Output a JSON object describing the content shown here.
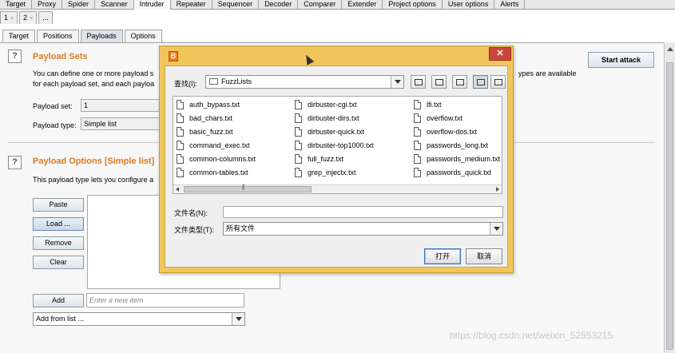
{
  "main_tabs": [
    "Target",
    "Proxy",
    "Spider",
    "Scanner",
    "Intruder",
    "Repeater",
    "Sequencer",
    "Decoder",
    "Comparer",
    "Extender",
    "Project options",
    "User options",
    "Alerts"
  ],
  "sub_tabs": [
    {
      "label": "1",
      "close": "×"
    },
    {
      "label": "2",
      "close": "×"
    },
    {
      "label": "...",
      "close": ""
    }
  ],
  "intruder_tabs": [
    "Target",
    "Positions",
    "Payloads",
    "Options"
  ],
  "payload_sets": {
    "help": "?",
    "title": "Payload Sets",
    "desc_line1_left": "You can define one or more payload s",
    "desc_line1_right": "ypes are available",
    "desc_line2": "for each payload set, and each payloa",
    "set_label": "Payload set:",
    "set_value": "1",
    "type_label": "Payload type:",
    "type_value": "Simple list"
  },
  "start_attack": "Start attack",
  "payload_options": {
    "help": "?",
    "title": "Payload Options [Simple list]",
    "desc": "This payload type lets you configure a",
    "buttons": [
      "Paste",
      "Load ...",
      "Remove",
      "Clear"
    ],
    "add_label": "Add",
    "add_placeholder": "Enter a new item",
    "add_from_list": "Add from list ..."
  },
  "dialog": {
    "logo": "B",
    "close": "✕",
    "lookin_label": "查找(I):",
    "lookin_value": "FuzzLists",
    "files": [
      "auth_bypass.txt",
      "bad_chars.txt",
      "basic_fuzz.txt",
      "command_exec.txt",
      "common-columns.txt",
      "common-tables.txt",
      "dirbuster-cgi.txt",
      "dirbuster-dirs.txt",
      "dirbuster-quick.txt",
      "dirbuster-top1000.txt",
      "full_fuzz.txt",
      "grep_injectx.txt",
      "lfi.txt",
      "overflow.txt",
      "overflow-dos.txt",
      "passwords_long.txt",
      "passwords_medium.txt",
      "passwords_quick.txt"
    ],
    "filename_label": "文件名(N):",
    "filename_value": "",
    "filetype_label": "文件类型(T):",
    "filetype_value": "所有文件",
    "open_button": "打开",
    "cancel_button": "取消"
  },
  "watermark": "https://blog.csdn.net/weixin_52553215",
  "colors": {
    "accent": "#e07a1f",
    "dialog_frame": "#f2c55c",
    "close_red": "#c9483b"
  }
}
